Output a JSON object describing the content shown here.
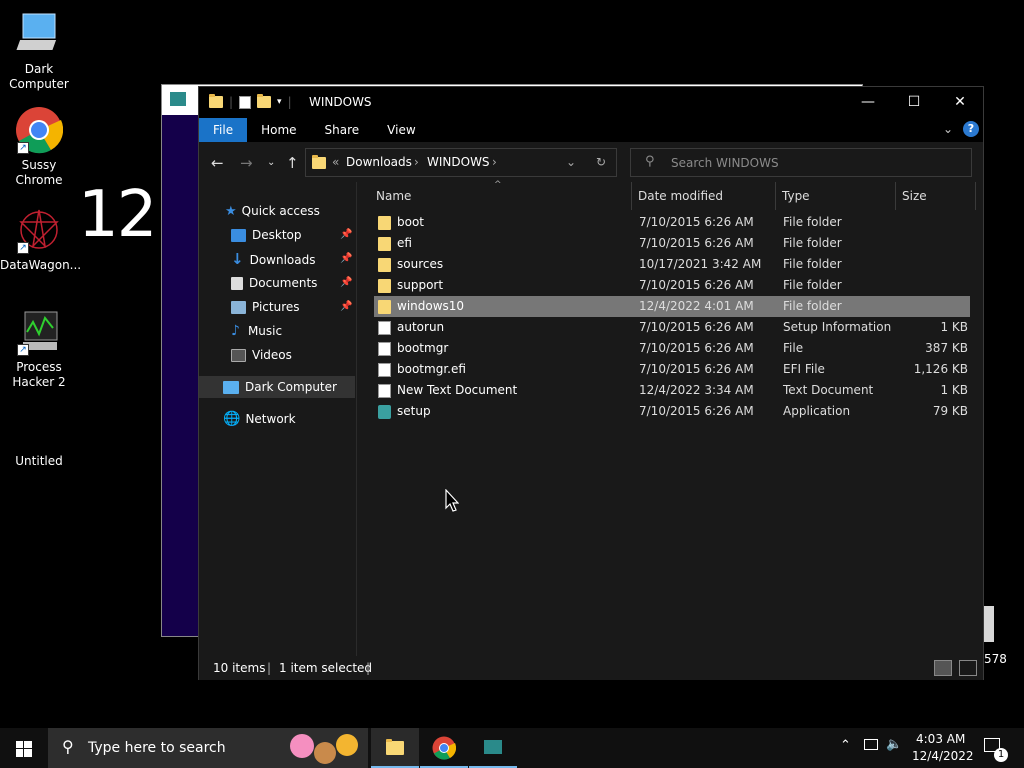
{
  "desktop": {
    "icons": [
      {
        "label": "Dark Computer"
      },
      {
        "label": "Sussy Chrome"
      },
      {
        "label": "DataWagon..."
      },
      {
        "label": "Process Hacker 2"
      },
      {
        "label": "Untitled"
      }
    ],
    "clock_overlay": "12",
    "partial_label": "578"
  },
  "explorer": {
    "title": "WINDOWS",
    "ribbon_tabs": [
      "File",
      "Home",
      "Share",
      "View"
    ],
    "breadcrumb": [
      "Downloads",
      "WINDOWS"
    ],
    "search_placeholder": "Search WINDOWS",
    "nav": {
      "quick_access": "Quick access",
      "items": [
        "Desktop",
        "Downloads",
        "Documents",
        "Pictures",
        "Music",
        "Videos"
      ],
      "this_pc": "Dark Computer",
      "network": "Network"
    },
    "columns": [
      "Name",
      "Date modified",
      "Type",
      "Size"
    ],
    "files": [
      {
        "name": "boot",
        "date": "7/10/2015 6:26 AM",
        "type": "File folder",
        "size": "",
        "icon": "folder-icon"
      },
      {
        "name": "efi",
        "date": "7/10/2015 6:26 AM",
        "type": "File folder",
        "size": "",
        "icon": "folder-icon"
      },
      {
        "name": "sources",
        "date": "10/17/2021 3:42 AM",
        "type": "File folder",
        "size": "",
        "icon": "folder-icon"
      },
      {
        "name": "support",
        "date": "7/10/2015 6:26 AM",
        "type": "File folder",
        "size": "",
        "icon": "folder-icon"
      },
      {
        "name": "windows10",
        "date": "12/4/2022 4:01 AM",
        "type": "File folder",
        "size": "",
        "icon": "folder-icon",
        "selected": true
      },
      {
        "name": "autorun",
        "date": "7/10/2015 6:26 AM",
        "type": "Setup Information",
        "size": "1 KB",
        "icon": "settings-file-icon"
      },
      {
        "name": "bootmgr",
        "date": "7/10/2015 6:26 AM",
        "type": "File",
        "size": "387 KB",
        "icon": "file-icon"
      },
      {
        "name": "bootmgr.efi",
        "date": "7/10/2015 6:26 AM",
        "type": "EFI File",
        "size": "1,126 KB",
        "icon": "file-icon"
      },
      {
        "name": "New Text Document",
        "date": "12/4/2022 3:34 AM",
        "type": "Text Document",
        "size": "1 KB",
        "icon": "text-file-icon"
      },
      {
        "name": "setup",
        "date": "7/10/2015 6:26 AM",
        "type": "Application",
        "size": "79 KB",
        "icon": "app-icon"
      }
    ],
    "status": {
      "items": "10 items",
      "selected": "1 item selected"
    }
  },
  "taskbar": {
    "search_placeholder": "Type here to search",
    "time": "4:03 AM",
    "date": "12/4/2022",
    "notification_count": "1"
  }
}
